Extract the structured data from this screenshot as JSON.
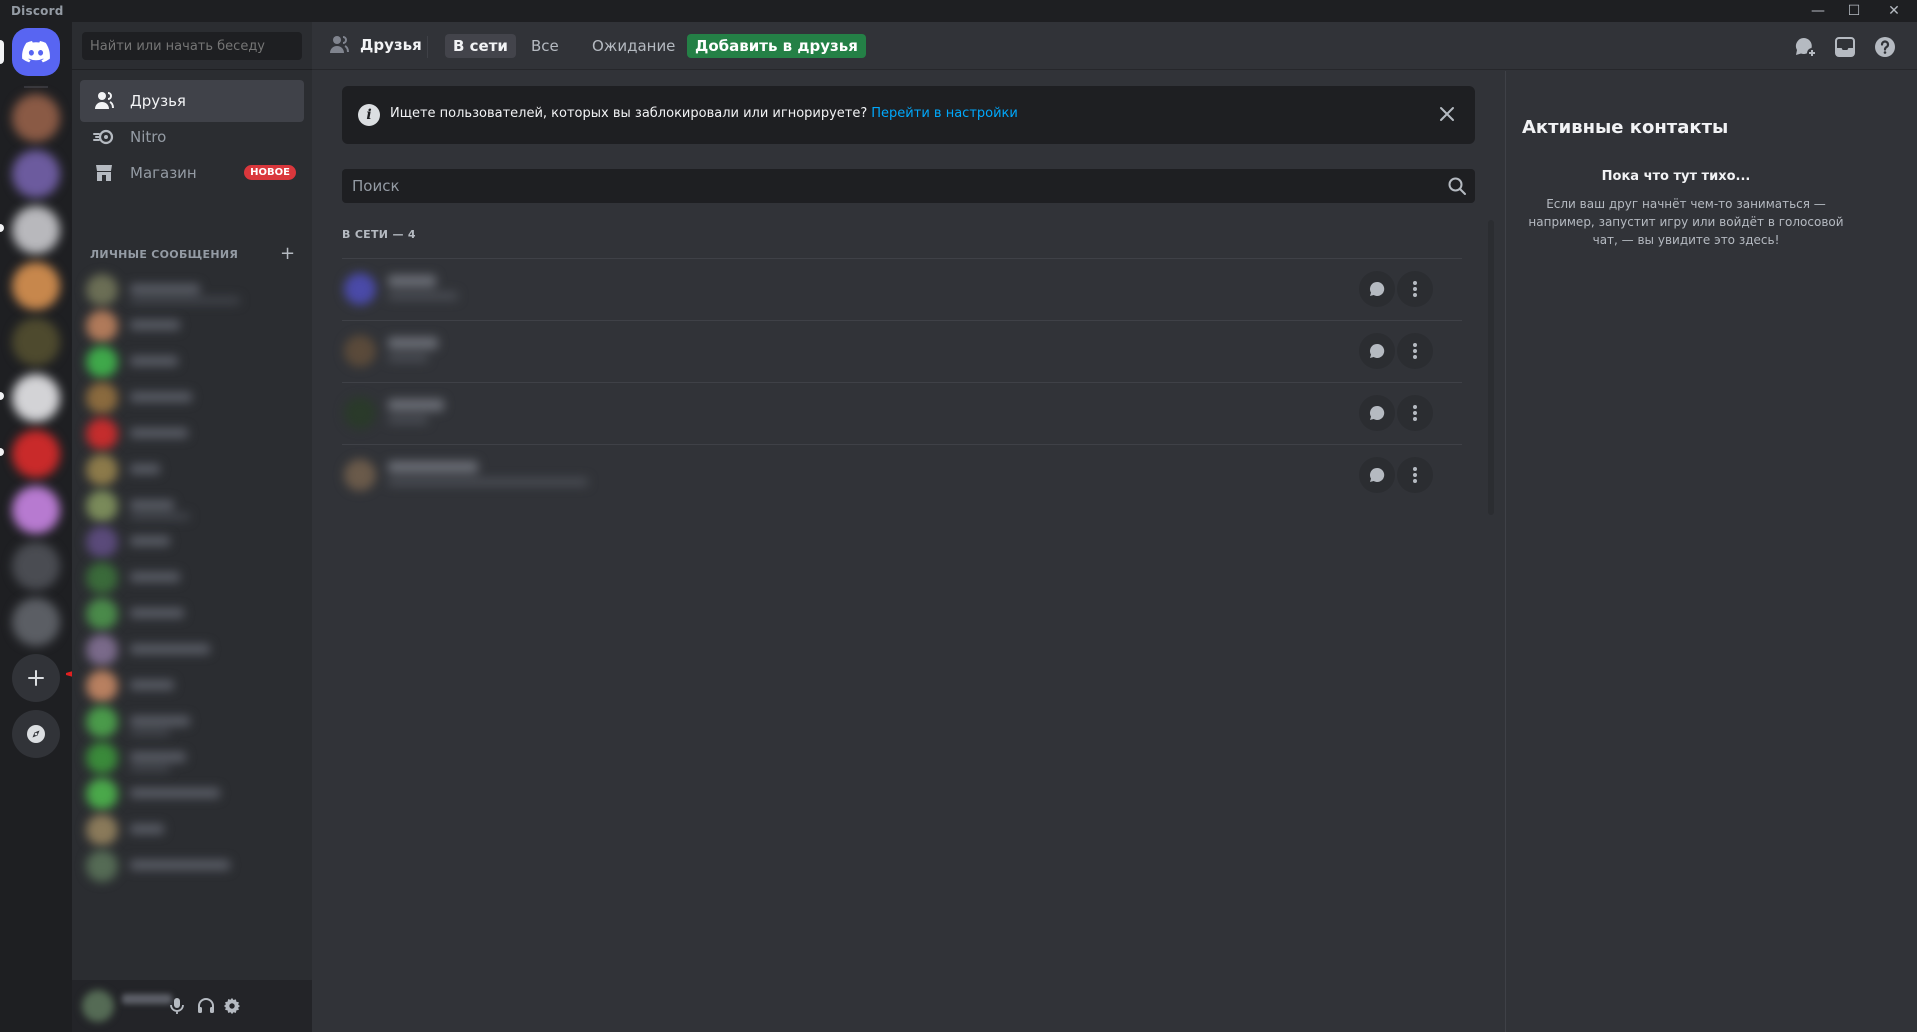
{
  "window": {
    "title": "Discord",
    "controls": {
      "minimize": "—",
      "maximize": "☐",
      "close": "✕"
    }
  },
  "guilds": {
    "items": [
      {
        "color": "#8a5a45"
      },
      {
        "color": "#6c5b9e"
      },
      {
        "color": "#b8b8bc"
      },
      {
        "color": "#c7874c"
      },
      {
        "color": "#4e4a2e"
      },
      {
        "color": "#d3d3d6"
      },
      {
        "color": "#c92a2a"
      },
      {
        "color": "#b77ad0"
      },
      {
        "color": "#4a4c52"
      },
      {
        "color": "#5b5e64"
      }
    ],
    "add_server_icon": "plus-icon",
    "discover_icon": "compass-icon"
  },
  "sidebar": {
    "search_placeholder": "Найти или начать беседу",
    "nav": [
      {
        "label": "Друзья",
        "icon": "friends-icon",
        "active": true
      },
      {
        "label": "Nitro",
        "icon": "nitro-icon",
        "active": false
      },
      {
        "label": "Магазин",
        "icon": "shop-icon",
        "active": false,
        "badge": "НОВОЕ"
      }
    ],
    "dm_header": "ЛИЧНЫЕ СООБЩЕНИЯ",
    "dm_add": "+",
    "dm_items": [
      {
        "color": "#6b6e55"
      },
      {
        "color": "#b07a5a"
      },
      {
        "color": "#3fa84a"
      },
      {
        "color": "#8a6a3e"
      },
      {
        "color": "#c42d2d"
      },
      {
        "color": "#8c7a4a"
      },
      {
        "color": "#7a8a5a"
      },
      {
        "color": "#5a4a7a"
      },
      {
        "color": "#3a6a3a"
      },
      {
        "color": "#4a8a4a"
      },
      {
        "color": "#7a6a8a"
      },
      {
        "color": "#b88060"
      },
      {
        "color": "#4a9a4a"
      },
      {
        "color": "#3a8a3a"
      },
      {
        "color": "#4aa84a"
      },
      {
        "color": "#8a7a5a"
      },
      {
        "color": "#556b55"
      }
    ],
    "userbar": {
      "mic_icon": "microphone-icon",
      "headset_icon": "headphones-icon",
      "settings_icon": "gear-icon"
    }
  },
  "header": {
    "title": "Друзья",
    "tabs": [
      {
        "label": "В сети",
        "selected": true
      },
      {
        "label": "Все",
        "selected": false
      },
      {
        "label": "Ожидание",
        "selected": false
      }
    ],
    "add_friend": "Добавить в друзья",
    "icons": [
      "new-group-dm-icon",
      "inbox-icon",
      "help-icon"
    ]
  },
  "banner": {
    "text": "Ищете пользователей, которых вы заблокировали или игнорируете?",
    "link": "Перейти в настройки"
  },
  "friends": {
    "search_placeholder": "Поиск",
    "online_header": "В СЕТИ — 4",
    "rows": [
      {
        "avatar_color": "#4a4aa8"
      },
      {
        "avatar_color": "#5a4a3a"
      },
      {
        "avatar_color": "#2a3a2a"
      },
      {
        "avatar_color": "#6a5a4a"
      }
    ]
  },
  "aside": {
    "title": "Активные контакты",
    "quiet": "Пока что тут тихо...",
    "desc": "Если ваш друг начнёт чем-то заниматься — например, запустит игру или войдёт в голосовой чат, — вы увидите это здесь!"
  },
  "colors": {
    "blurple": "#5865f2",
    "green": "#248046",
    "red": "#da373c",
    "link": "#00a8fc",
    "annotation_arrow": "#e02020"
  }
}
